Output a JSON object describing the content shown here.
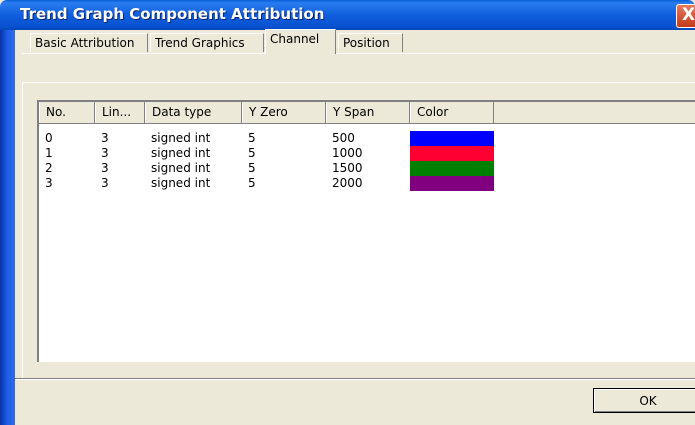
{
  "window": {
    "title": "Trend Graph Component Attribution",
    "close_glyph": "X"
  },
  "tabs": [
    {
      "label": "Basic Attribution",
      "active": false
    },
    {
      "label": "Trend Graphics",
      "active": false
    },
    {
      "label": "Channel",
      "active": true
    },
    {
      "label": "Position",
      "active": false
    }
  ],
  "table": {
    "columns": [
      "No.",
      "Lin...",
      "Data type",
      "Y Zero",
      "Y Span",
      "Color"
    ],
    "rows": [
      {
        "no": "0",
        "line": "3",
        "data_type": "signed int",
        "y_zero": "5",
        "y_span": "500",
        "color": "#0000ff"
      },
      {
        "no": "1",
        "line": "3",
        "data_type": "signed int",
        "y_zero": "5",
        "y_span": "1000",
        "color": "#ff0033"
      },
      {
        "no": "2",
        "line": "3",
        "data_type": "signed int",
        "y_zero": "5",
        "y_span": "1500",
        "color": "#008000"
      },
      {
        "no": "3",
        "line": "3",
        "data_type": "signed int",
        "y_zero": "5",
        "y_span": "2000",
        "color": "#800080"
      }
    ]
  },
  "buttons": {
    "ok_label": "OK"
  }
}
